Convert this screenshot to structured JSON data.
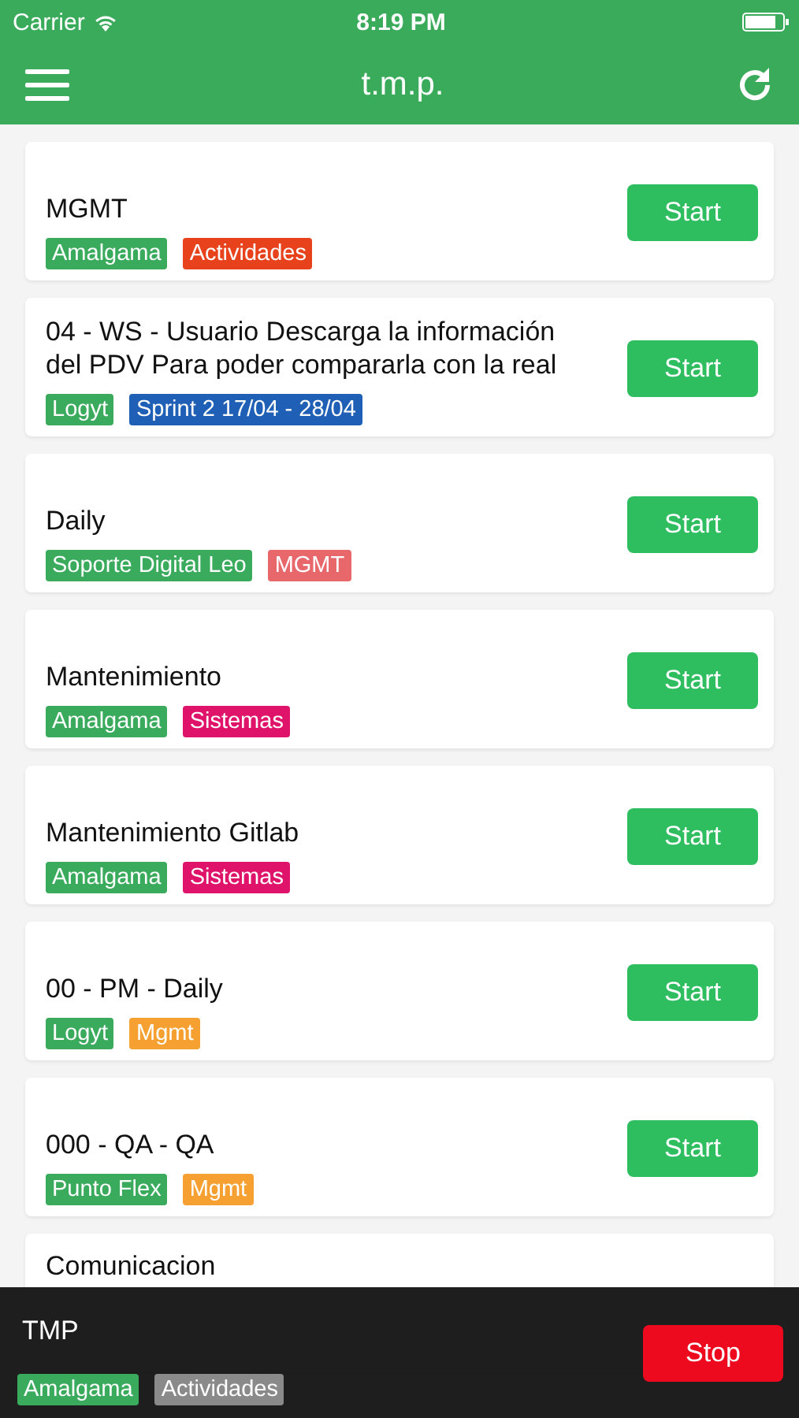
{
  "status_bar": {
    "carrier": "Carrier",
    "time": "8:19 PM"
  },
  "header": {
    "title": "t.m.p."
  },
  "tasks": [
    {
      "title": "MGMT",
      "kind": "full",
      "button": "Start",
      "tags": [
        {
          "label": "Amalgama",
          "color": "#3aaa5c"
        },
        {
          "label": "Actividades",
          "color": "#e8421c"
        }
      ]
    },
    {
      "title": "04 - WS -  Usuario Descarga la información del PDV Para poder compararla con la real",
      "kind": "full",
      "button": "Start",
      "tags": [
        {
          "label": "Logyt",
          "color": "#3aaa5c"
        },
        {
          "label": "Sprint 2 17/04 - 28/04",
          "color": "#1f5fb5"
        }
      ]
    },
    {
      "title": "Daily",
      "kind": "full",
      "button": "Start",
      "tags": [
        {
          "label": "Soporte Digital Leo",
          "color": "#3aaa5c"
        },
        {
          "label": "MGMT",
          "color": "#e8676b"
        }
      ]
    },
    {
      "title": "Mantenimiento",
      "kind": "full",
      "button": "Start",
      "tags": [
        {
          "label": "Amalgama",
          "color": "#3aaa5c"
        },
        {
          "label": "Sistemas",
          "color": "#e0136a"
        }
      ]
    },
    {
      "title": "Mantenimiento Gitlab",
      "kind": "full",
      "button": "Start",
      "tags": [
        {
          "label": "Amalgama",
          "color": "#3aaa5c"
        },
        {
          "label": "Sistemas",
          "color": "#e0136a"
        }
      ]
    },
    {
      "title": "00 - PM - Daily",
      "kind": "full",
      "button": "Start",
      "tags": [
        {
          "label": "Logyt",
          "color": "#3aaa5c"
        },
        {
          "label": "Mgmt",
          "color": "#f5a030"
        }
      ]
    },
    {
      "title": "000 - QA - QA",
      "kind": "full",
      "button": "Start",
      "tags": [
        {
          "label": "Punto Flex",
          "color": "#3aaa5c"
        },
        {
          "label": "Mgmt",
          "color": "#f5a030"
        }
      ]
    },
    {
      "title": "Comunicacion",
      "kind": "partial"
    }
  ],
  "current": {
    "title": "TMP",
    "button": "Stop",
    "tags": [
      {
        "label": "Amalgama",
        "color": "#3aaa5c"
      },
      {
        "label": "Actividades",
        "color": "#8a8a8a"
      }
    ]
  }
}
